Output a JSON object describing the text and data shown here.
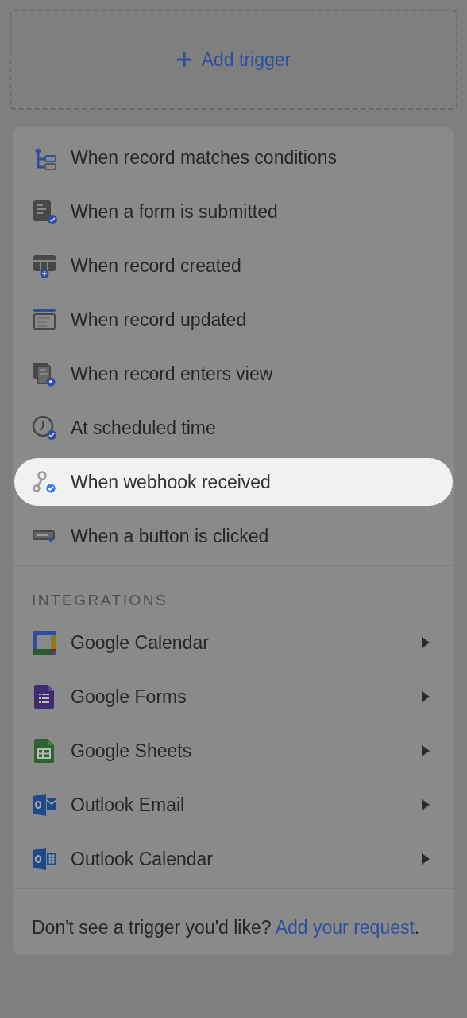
{
  "add_trigger": {
    "label": "Add trigger"
  },
  "triggers": [
    {
      "label": "When record matches conditions",
      "kind": "conditions",
      "selected": false
    },
    {
      "label": "When a form is submitted",
      "kind": "form",
      "selected": false
    },
    {
      "label": "When record created",
      "kind": "created",
      "selected": false
    },
    {
      "label": "When record updated",
      "kind": "updated",
      "selected": false
    },
    {
      "label": "When record enters view",
      "kind": "view",
      "selected": false
    },
    {
      "label": "At scheduled time",
      "kind": "clock",
      "selected": false
    },
    {
      "label": "When webhook received",
      "kind": "webhook",
      "selected": true
    },
    {
      "label": "When a button is clicked",
      "kind": "button",
      "selected": false
    }
  ],
  "integrations": {
    "heading": "INTEGRATIONS",
    "items": [
      {
        "label": "Google Calendar",
        "kind": "gcal"
      },
      {
        "label": "Google Forms",
        "kind": "gforms"
      },
      {
        "label": "Google Sheets",
        "kind": "gsheets"
      },
      {
        "label": "Outlook Email",
        "kind": "omail"
      },
      {
        "label": "Outlook Calendar",
        "kind": "ocal"
      }
    ]
  },
  "footer": {
    "text": "Don't see a trigger you'd like?",
    "link": "Add your request",
    "after": "."
  }
}
